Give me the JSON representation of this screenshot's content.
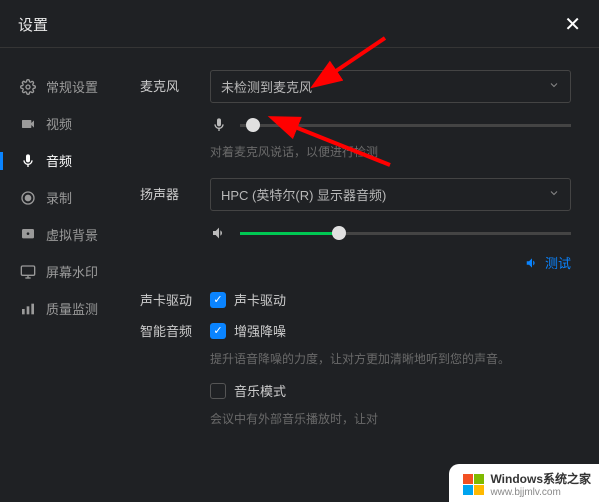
{
  "header": {
    "title": "设置"
  },
  "sidebar": {
    "items": [
      {
        "label": "常规设置",
        "icon": "gear"
      },
      {
        "label": "视频",
        "icon": "video"
      },
      {
        "label": "音频",
        "icon": "mic",
        "active": true
      },
      {
        "label": "录制",
        "icon": "record"
      },
      {
        "label": "虚拟背景",
        "icon": "background"
      },
      {
        "label": "屏幕水印",
        "icon": "screen"
      },
      {
        "label": "质量监测",
        "icon": "quality"
      }
    ]
  },
  "main": {
    "microphone": {
      "label": "麦克风",
      "selected": "未检测到麦克风",
      "slider_value": 3,
      "hint": "对着麦克风说话，以便进行检测"
    },
    "speaker": {
      "label": "扬声器",
      "selected": "HPC (英特尔(R) 显示器音频)",
      "slider_value": 30,
      "test_label": "测试"
    },
    "driver": {
      "label": "声卡驱动",
      "checkbox_label": "声卡驱动",
      "checked": true
    },
    "smart_audio": {
      "label": "智能音频",
      "noise_label": "增强降噪",
      "noise_checked": true,
      "noise_hint": "提升语音降噪的力度，让对方更加清晰地听到您的声音。",
      "music_label": "音乐模式",
      "music_checked": false,
      "music_hint": "会议中有外部音乐播放时，让对"
    }
  },
  "watermark": {
    "title": "Windows系统之家",
    "url": "www.bjjmlv.com"
  }
}
